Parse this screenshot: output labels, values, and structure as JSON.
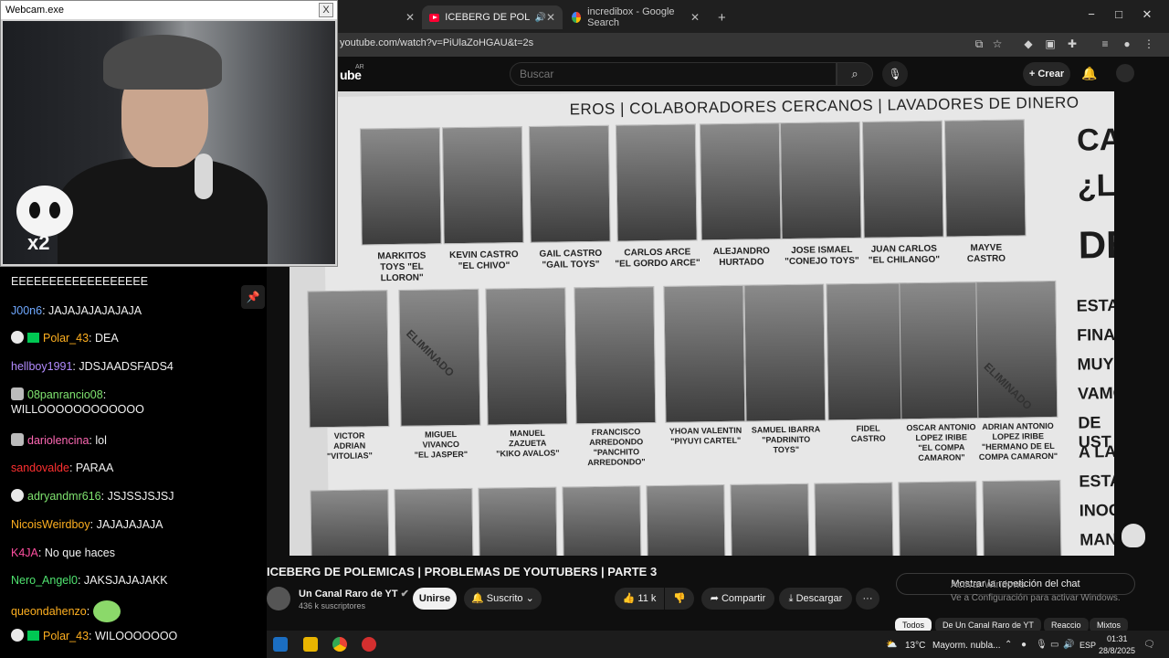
{
  "browser": {
    "tabs": [
      {
        "label": "",
        "icon": "unknown-tab-icon"
      },
      {
        "label": "ICEBERG DE POLEMICAS | P",
        "icon": "youtube-icon"
      },
      {
        "label": "incredibox - Google Search",
        "icon": "google-icon"
      }
    ],
    "new_tab": "+",
    "url": "youtube.com/watch?v=PiUlaZoHGAU&t=2s",
    "window_buttons": {
      "minimize": "−",
      "maximize": "□",
      "close": "✕"
    }
  },
  "youtube": {
    "logo": "ube",
    "country": "AR",
    "search_placeholder": "Buscar",
    "create_label": "Crear",
    "video": {
      "poster_title": "EROS | COLABORADORES CERCANOS | LAVADORES DE DINERO",
      "row1_labels": [
        "MARKITOS\nTOYS \"EL LLORON\"",
        "KEVIN CASTRO\n\"EL CHIVO\"",
        "GAIL CASTRO\n\"GAIL TOYS\"",
        "CARLOS ARCE\n\"EL GORDO ARCE\"",
        "ALEJANDRO\nHURTADO",
        "JOSE ISMAEL\n\"CONEJO TOYS\"",
        "JUAN CARLOS\n\"EL CHILANGO\"",
        "MAYVE\nCASTRO"
      ],
      "row2_labels": [
        "VICTOR\nADRIAN\n\"VITOLIAS\"",
        "MIGUEL\nVIVANCO\n\"EL JASPER\"",
        "MANUEL\nZAZUETA\n\"KIKO AVALOS\"",
        "FRANCISCO\nARREDONDO\n\"PANCHITO\nARREDONDO\"",
        "YHOAN VALENTIN\n\"PIYUYI CARTEL\"",
        "SAMUEL IBARRA\n\"PADRINITO\nTOYS\"",
        "FIDEL\nCASTRO",
        "OSCAR ANTONIO\nLOPEZ IRIBE\n\"EL COMPA\nCAMARON\"",
        "ADRIAN ANTONIO\nLOPEZ IRIBE\n\"HERMANO DE EL\nCOMPA CAMARON\""
      ],
      "stamp": "ELIMINADO",
      "side_text": [
        "CA",
        "¿L",
        "DE",
        "ESTAS",
        "FINAN",
        "MUY",
        "VAMOS",
        "DE UST",
        "A LA",
        "ESTAS",
        "INOCENT",
        "MANERA"
      ]
    },
    "title": "ICEBERG DE POLEMICAS | PROBLEMAS DE YOUTUBERS | PARTE 3",
    "channel": {
      "name": "Un Canal Raro de YT",
      "subscribers": "436 k suscriptores"
    },
    "join_label": "Unirse",
    "subscribed_label": "Suscrito",
    "likes": "11 k",
    "share_label": "Compartir",
    "download_label": "Descargar",
    "more_label": "···",
    "chat_replay_label": "Mostrar la repetición del chat",
    "activate_windows": {
      "title": "Activar Windows",
      "body": "Ve a Configuración para activar Windows."
    },
    "chips": [
      "Todos",
      "De Un Canal Raro de YT",
      "Reaccio",
      "Mixtos"
    ]
  },
  "webcam": {
    "title": "Webcam.exe",
    "close": "X",
    "logo_text": "x2"
  },
  "chat": {
    "messages": [
      {
        "user": "",
        "user_color": "#f1f1f1",
        "text": "EEEEEEEEEEEEEEEEEE",
        "badges": []
      },
      {
        "user": "J00n6",
        "user_color": "#6fa8ff",
        "text": "JAJAJAJAJAJAJA",
        "badges": []
      },
      {
        "user": "Polar_43",
        "user_color": "#ffb020",
        "text": "DEA",
        "badges": [
          "skull",
          "sub"
        ]
      },
      {
        "user": "hellboy1991",
        "user_color": "#b38cff",
        "text": "JDSJAADSFADS4",
        "badges": []
      },
      {
        "user": "08panrancio08",
        "user_color": "#7fe36f",
        "text": "WILLOOOOOOOOOOOO",
        "badges": [
          "crown"
        ]
      },
      {
        "user": "dariolencina",
        "user_color": "#ff69b4",
        "text": "lol",
        "badges": [
          "crown"
        ]
      },
      {
        "user": "sandovalde",
        "user_color": "#ff3030",
        "text": "PARAA",
        "badges": []
      },
      {
        "user": "adryandmr616",
        "user_color": "#7fe36f",
        "text": "JSJSSJSJSJ",
        "badges": [
          "skull"
        ]
      },
      {
        "user": "NicoisWeirdboy",
        "user_color": "#ffb020",
        "text": "JAJAJAJAJA",
        "badges": []
      },
      {
        "user": "K4JA",
        "user_color": "#ff4fa0",
        "text": "No que haces",
        "badges": []
      },
      {
        "user": "Nero_Angel0",
        "user_color": "#4fe36f",
        "text": "JAKSJAJAJAKK",
        "badges": []
      },
      {
        "user": "queondahenzo",
        "user_color": "#ffb020",
        "text": "",
        "badges": [],
        "emote": true
      },
      {
        "user": "Polar_43",
        "user_color": "#ffb020",
        "text": "WILOOOOOOO",
        "badges": [
          "skull",
          "sub"
        ]
      }
    ]
  },
  "taskbar": {
    "weather_temp": "13°C",
    "weather_desc": "Mayorm. nubla...",
    "language": "ESP",
    "time": "01:31",
    "date": "28/8/2025"
  }
}
